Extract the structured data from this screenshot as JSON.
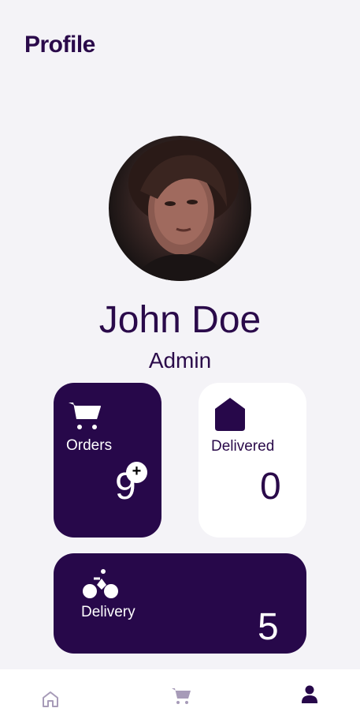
{
  "header": {
    "title": "Profile"
  },
  "profile": {
    "name": "John Doe",
    "role": "Admin",
    "avatar_icon": "user-photo"
  },
  "stats": {
    "orders": {
      "label": "Orders",
      "value": "9",
      "icon": "cart-icon",
      "badge": "+"
    },
    "delivered": {
      "label": "Delivered",
      "value": "0",
      "icon": "house-icon"
    },
    "delivery": {
      "label": "Delivery",
      "value": "5",
      "icon": "bike-icon"
    }
  },
  "nav": {
    "items": [
      {
        "name": "home",
        "icon": "home-icon",
        "active": false
      },
      {
        "name": "cart",
        "icon": "cart-icon",
        "active": false
      },
      {
        "name": "profile",
        "icon": "person-icon",
        "active": true
      }
    ]
  },
  "colors": {
    "primary": "#27084a",
    "background": "#f4f3f7",
    "card_light": "#ffffff",
    "nav_inactive": "#a79bb8"
  }
}
